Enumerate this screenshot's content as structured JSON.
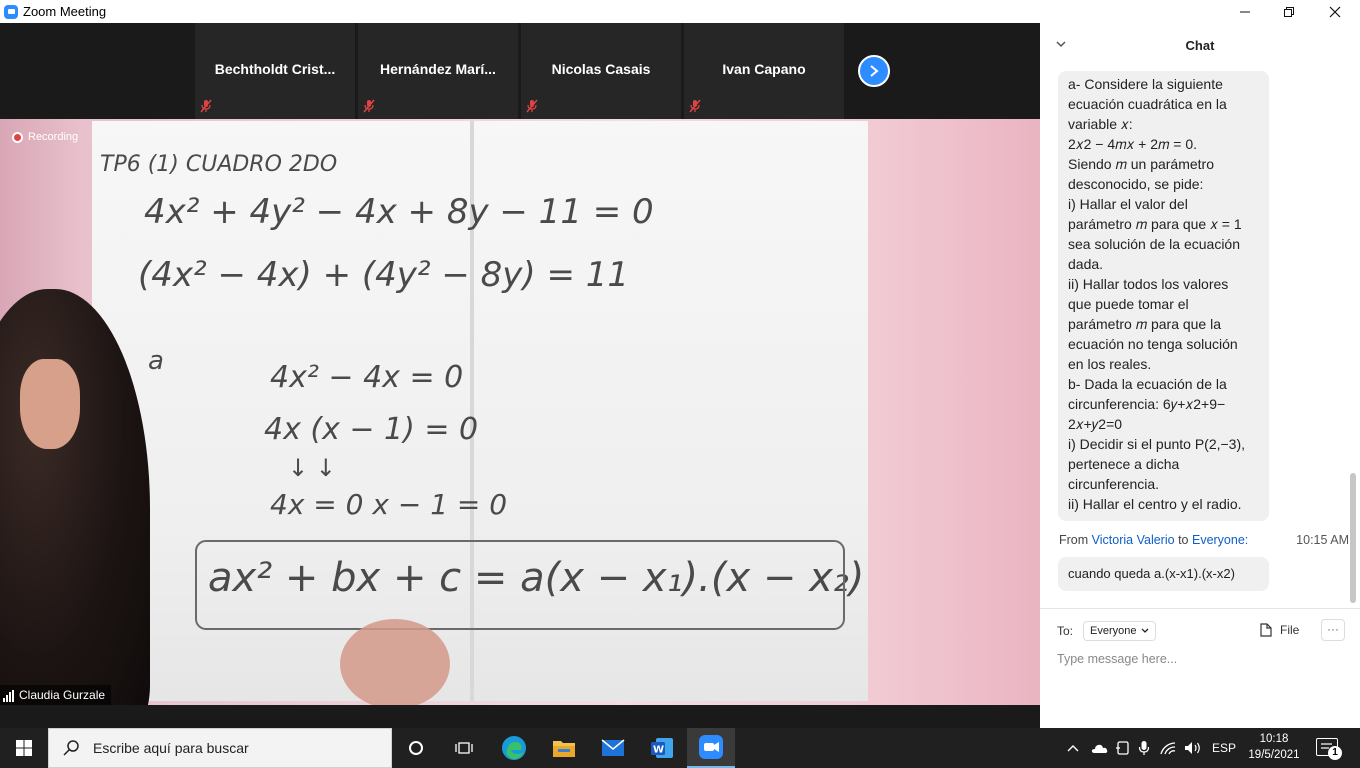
{
  "window": {
    "title": "Zoom Meeting"
  },
  "participants": [
    {
      "name": "Bechtholdt  Crist..."
    },
    {
      "name": "Hernández  Marí..."
    },
    {
      "name": "Nicolas Casais"
    },
    {
      "name": "Ivan Capano"
    }
  ],
  "video": {
    "recording_label": "Recording",
    "speaker_name": "Claudia Gurzale"
  },
  "whiteboard": {
    "lines": [
      "TP6 (1) CUADRO 2DO",
      "4x² + 4y² − 4x + 8y − 11 = 0",
      "(4x² − 4x) + (4y² − 8y) = 11",
      "a",
      "4x² − 4x = 0",
      "4x (x − 1) = 0",
      "↓        ↓",
      "4x = 0     x − 1 = 0",
      "ax² + bx + c = a(x − x₁).(x − x₂)"
    ]
  },
  "chat": {
    "title": "Chat",
    "message1_lines": [
      "a- Considere la siguiente",
      "ecuación cuadrática en la",
      "variable 𝑥:",
      "2𝑥2 − 4𝑚𝑥 + 2𝑚 = 0.",
      "Siendo 𝑚 un parámetro",
      "desconocido, se pide:",
      "i) Hallar el valor del",
      "parámetro 𝑚 para que 𝑥 = 1",
      "sea solución de la ecuación",
      "dada.",
      "ii) Hallar todos los valores",
      "que puede tomar el",
      "parámetro 𝑚 para que la",
      "ecuación no tenga solución",
      "en los reales.",
      "b- Dada la ecuación de la",
      "circunferencia: 6𝑦+𝑥2+9−",
      "2𝑥+𝑦2=0",
      "i) Decidir si el punto P(2,−3),",
      "pertenece a dicha",
      "circunferencia.",
      "ii) Hallar el centro y el radio."
    ],
    "from_label": "From",
    "sender": "Victoria Valerio",
    "to_word": "to",
    "recipient": "Everyone:",
    "time": "10:15 AM",
    "message2": "cuando queda a.(x-x1).(x-x2)",
    "to_label": "To:",
    "to_value": "Everyone",
    "file_label": "File",
    "more_label": "···",
    "input_placeholder": "Type message here..."
  },
  "taskbar": {
    "search_placeholder": "Escribe aquí para buscar",
    "language": "ESP",
    "time": "10:18",
    "date": "19/5/2021",
    "notification_count": "1"
  },
  "colors": {
    "zoom_blue": "#2d8cff",
    "link_blue": "#0e5fc7",
    "recording_red": "#e04343",
    "taskbar_bg": "#202020"
  }
}
